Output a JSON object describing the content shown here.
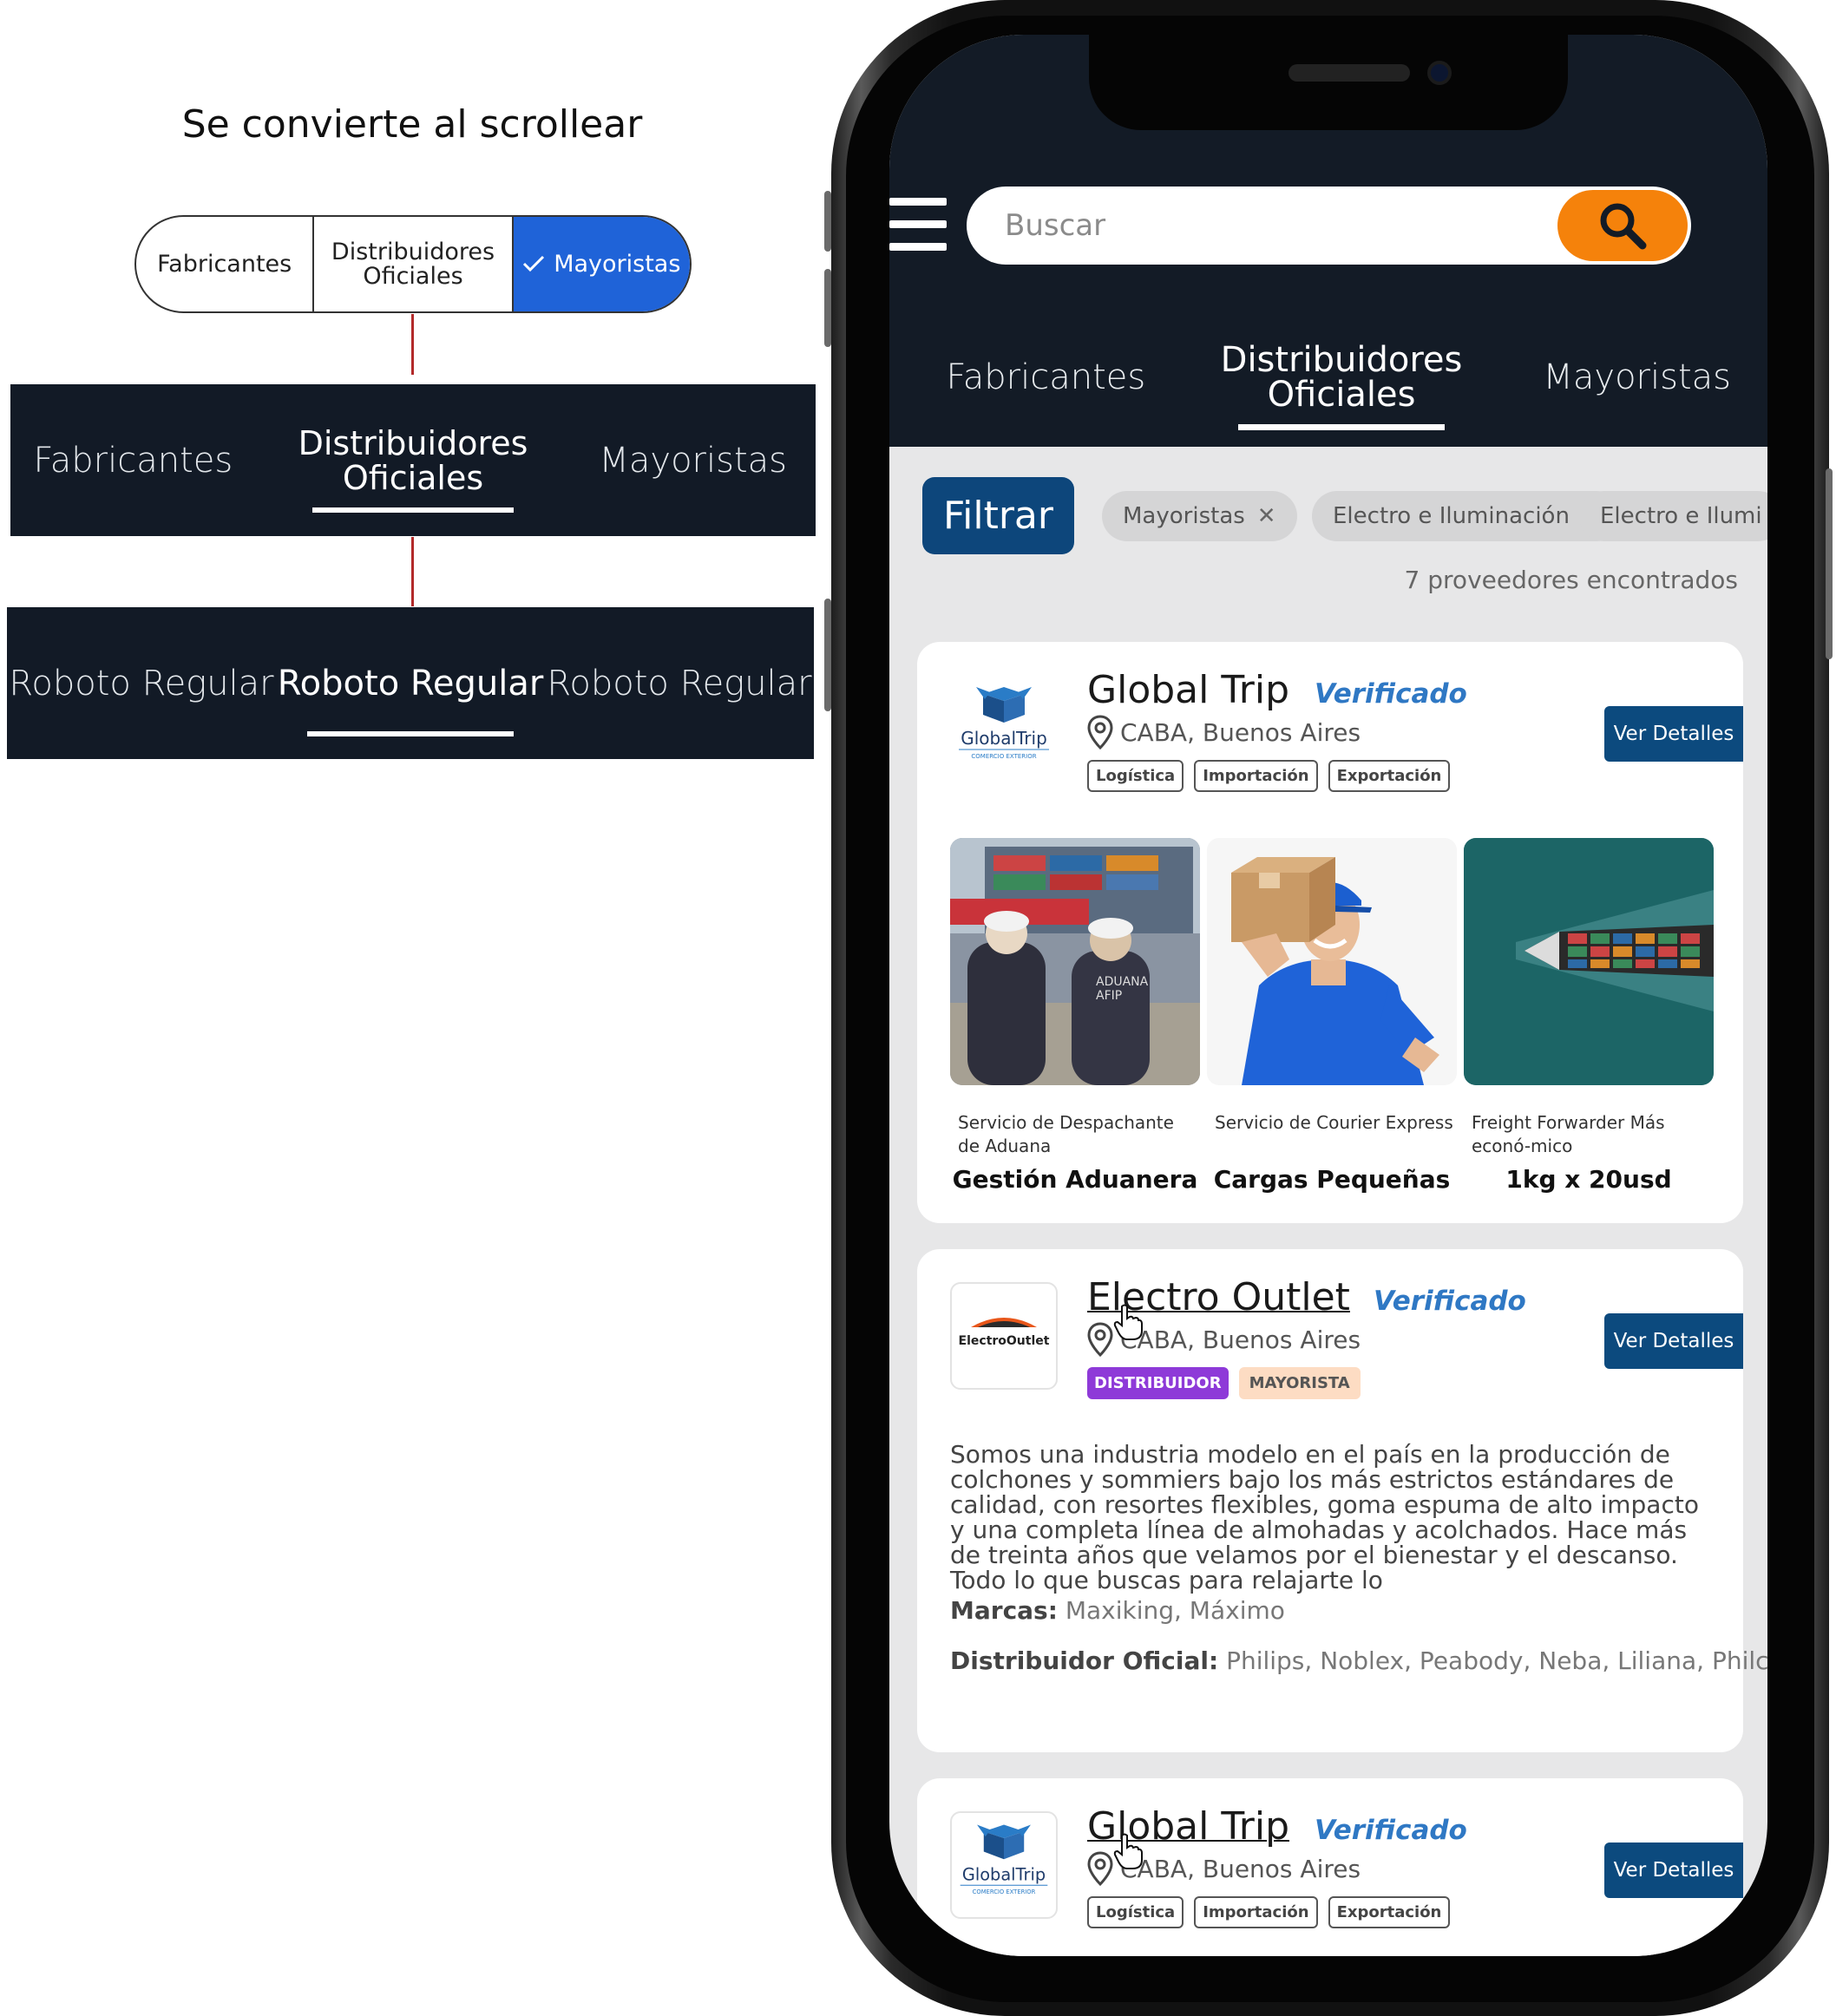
{
  "annotation": {
    "title": "Se convierte al scrollear",
    "segmented": {
      "items": [
        {
          "label": "Fabricantes"
        },
        {
          "label": "Distribuidores Oficiales"
        },
        {
          "label": "Mayoristas",
          "selected": true
        }
      ],
      "accent_color": "#1f63d8"
    },
    "tabbar": {
      "items": [
        "Fabricantes",
        "Distribuidores Oficiales",
        "Mayoristas"
      ],
      "active_index": 1
    },
    "font_demo": {
      "items": [
        "Roboto Regular",
        "Roboto Regular",
        "Roboto Regular"
      ],
      "active_index": 1
    }
  },
  "app": {
    "search": {
      "placeholder": "Buscar",
      "icon": "search-icon"
    },
    "tabs": [
      "Fabricantes",
      "Distribuidores Oficiales",
      "Mayoristas"
    ],
    "active_tab_index": 1,
    "filter_label": "Filtrar",
    "chips": [
      "Mayoristas",
      "Electro e Iluminación",
      "Electro e Ilumi"
    ],
    "result_count": "7 proveedores encontrados",
    "details_label": "Ver Detalles",
    "verified_label": "Verificado",
    "colors": {
      "header": "#131b26",
      "search_button": "#f5820b",
      "primary": "#0d467b",
      "verified": "#2f78c4"
    },
    "cards": [
      {
        "name": "Global Trip",
        "logo_text": "GlobalTrip",
        "logo_sub": "COMERCIO EXTERIOR",
        "location": "CABA, Buenos Aires",
        "tags": [
          "Logística",
          "Importación",
          "Exportación"
        ],
        "services": [
          {
            "caption": "Servicio de Despachante de Aduana",
            "offer": "Gestión Aduanera"
          },
          {
            "caption": "Servicio de Courier Express",
            "offer": "Cargas Pequeñas"
          },
          {
            "caption": "Freight Forwarder Más econó-mico",
            "offer": "1kg x 20usd"
          }
        ]
      },
      {
        "name": "Electro Outlet",
        "logo_text": "ElectroOutlet",
        "location": "CABA, Buenos Aires",
        "tags": [
          "DISTRIBUIDOR",
          "MAYORISTA"
        ],
        "description": "Somos una industria modelo en el país en la producción de colchones y sommiers bajo los más estrictos estándares de calidad, con resortes flexibles, goma espuma de alto impacto y una completa línea de almohadas y acolchados. Hace más de treinta años que velamos por el bienestar y el descanso. Todo lo que buscas para relajarte lo",
        "brands_label": "Marcas:",
        "brands": "Maxiking, Máximo",
        "official_label": "Distribuidor Oficial:",
        "official": "Philips, Noblex, Peabody, Neba, Liliana, Philco, Pa-"
      },
      {
        "name": "Global Trip",
        "logo_text": "GlobalTrip",
        "logo_sub": "COMERCIO EXTERIOR",
        "location": "CABA, Buenos Aires",
        "tags": [
          "Logística",
          "Importación",
          "Exportación"
        ]
      }
    ]
  }
}
